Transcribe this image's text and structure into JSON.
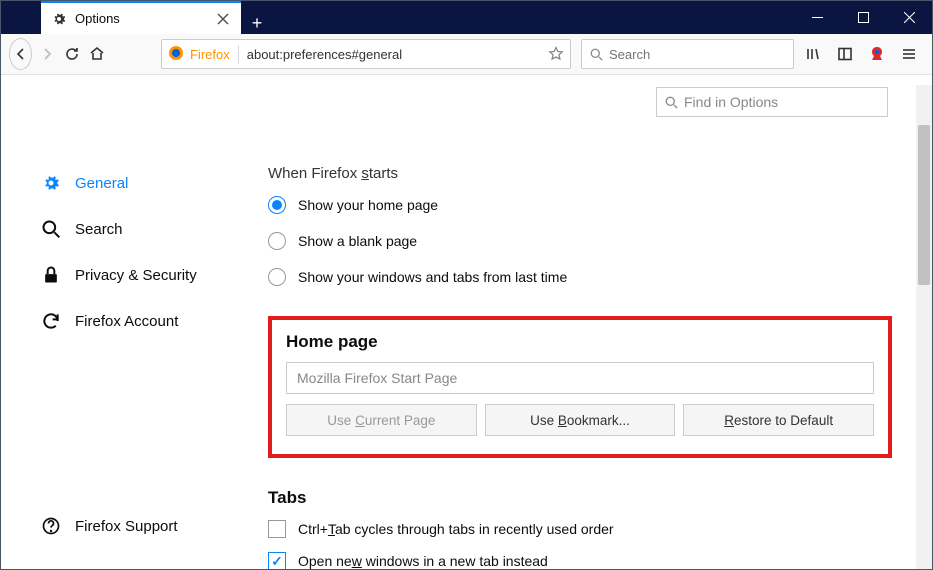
{
  "tab": {
    "title": "Options"
  },
  "urlbar": {
    "identity": "Firefox",
    "url": "about:preferences#general"
  },
  "searchbar": {
    "placeholder": "Search"
  },
  "find": {
    "placeholder": "Find in Options"
  },
  "sidebar": {
    "items": [
      {
        "label": "General"
      },
      {
        "label": "Search"
      },
      {
        "label": "Privacy & Security"
      },
      {
        "label": "Firefox Account"
      }
    ],
    "support": "Firefox Support"
  },
  "main": {
    "startup_title_prefix": "When Firefox ",
    "startup_title_underline": "s",
    "startup_title_suffix": "tarts",
    "radios": [
      "Show your home page",
      "Show a blank page",
      "Show your windows and tabs from last time"
    ],
    "homepage": {
      "title": "Home page",
      "input_value": "Mozilla Firefox Start Page",
      "btn1_pre": "Use ",
      "btn1_u": "C",
      "btn1_post": "urrent Page",
      "btn2_pre": "Use ",
      "btn2_u": "B",
      "btn2_post": "ookmark...",
      "btn3_u": "R",
      "btn3_post": "estore to Default"
    },
    "tabs": {
      "title": "Tabs",
      "chk1_pre": "Ctrl+",
      "chk1_u": "T",
      "chk1_post": "ab cycles through tabs in recently used order",
      "chk2_pre": "Open ne",
      "chk2_u": "w",
      "chk2_post": " windows in a new tab instead"
    }
  }
}
